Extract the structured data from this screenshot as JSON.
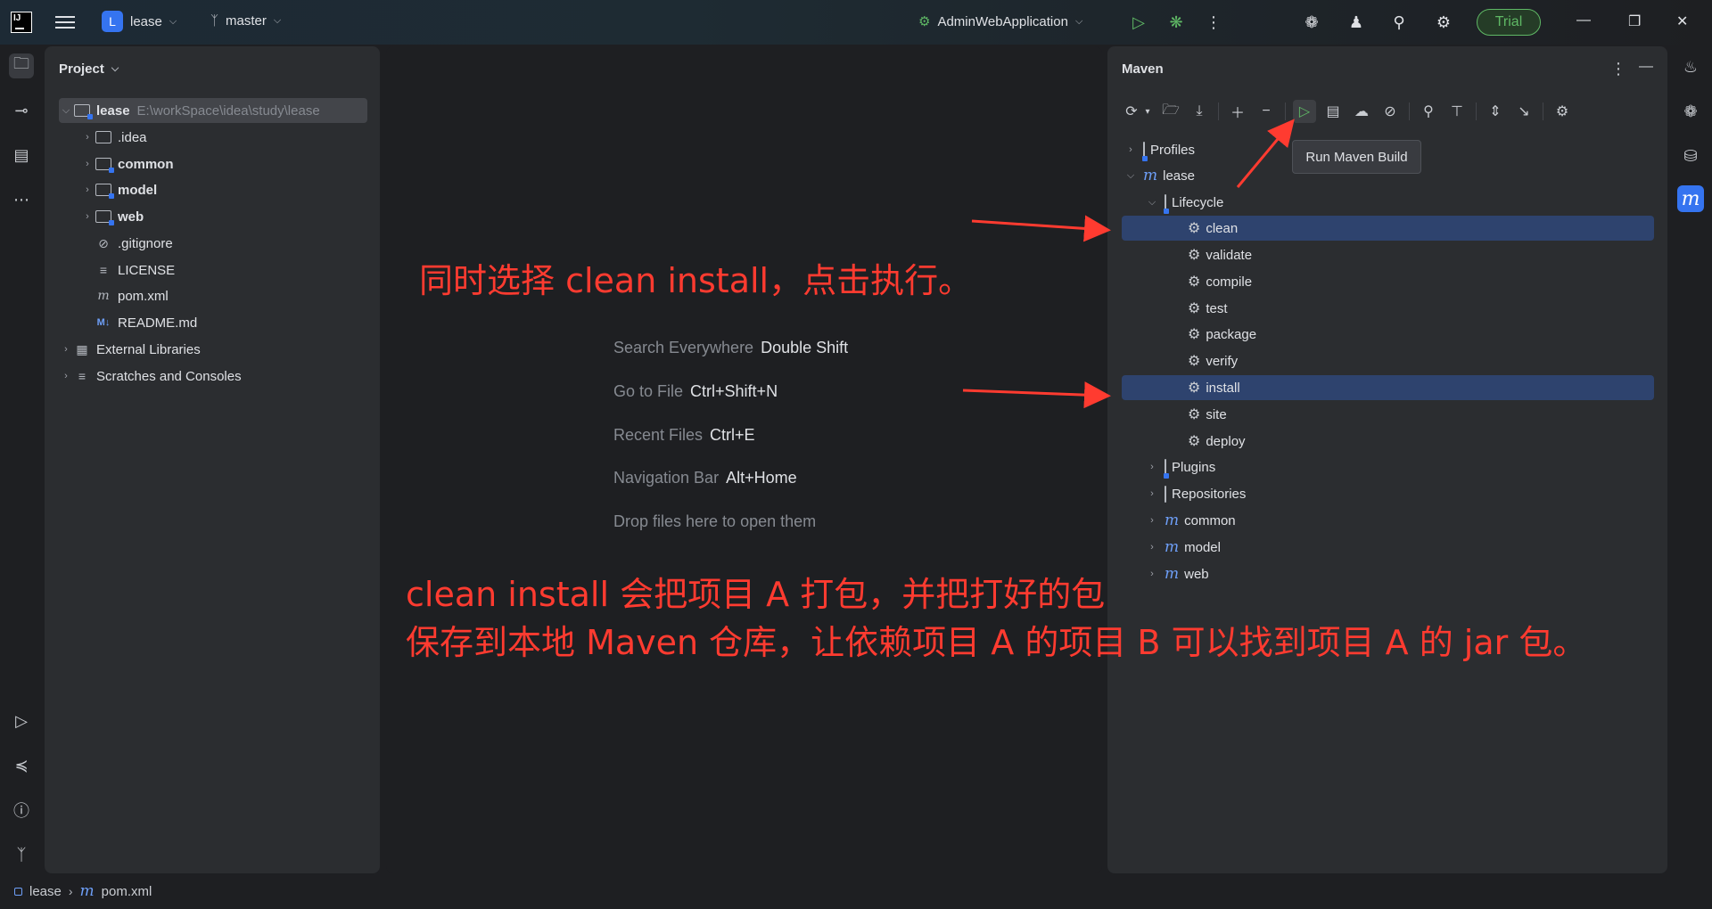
{
  "titlebar": {
    "project_badge": "L",
    "project_name": "lease",
    "branch": "master",
    "run_config": "AdminWebApplication",
    "trial_label": "Trial"
  },
  "project_panel": {
    "title": "Project",
    "root": {
      "name": "lease",
      "path": "E:\\workSpace\\idea\\study\\lease"
    },
    "items": [
      {
        "label": ".idea"
      },
      {
        "label": "common"
      },
      {
        "label": "model"
      },
      {
        "label": "web"
      },
      {
        "label": ".gitignore"
      },
      {
        "label": "LICENSE"
      },
      {
        "label": "pom.xml"
      },
      {
        "label": "README.md"
      },
      {
        "label": "External Libraries"
      },
      {
        "label": "Scratches and Consoles"
      }
    ]
  },
  "editor": {
    "hints": [
      {
        "label": "Search Everywhere",
        "key": "Double Shift"
      },
      {
        "label": "Go to File",
        "key": "Ctrl+Shift+N"
      },
      {
        "label": "Recent Files",
        "key": "Ctrl+E"
      },
      {
        "label": "Navigation Bar",
        "key": "Alt+Home"
      },
      {
        "label": "Drop files here to open them",
        "key": ""
      }
    ]
  },
  "annotations": {
    "top": "同时选择 clean install，点击执行。",
    "bottom_line1": "clean install 会把项目 A 打包，并把打好的包",
    "bottom_line2": "保存到本地 Maven 仓库，让依赖项目 A 的项目 B 可以找到项目 A 的 jar 包。"
  },
  "maven_panel": {
    "title": "Maven",
    "tooltip": "Run Maven Build",
    "tree": {
      "profiles": "Profiles",
      "root": "lease",
      "lifecycle": "Lifecycle",
      "phases": [
        "clean",
        "validate",
        "compile",
        "test",
        "package",
        "verify",
        "install",
        "site",
        "deploy"
      ],
      "plugins": "Plugins",
      "repositories": "Repositories",
      "modules": [
        "common",
        "model",
        "web"
      ]
    },
    "selected_phases": [
      "clean",
      "install"
    ]
  },
  "breadcrumb": {
    "project": "lease",
    "file": "pom.xml"
  },
  "colors": {
    "accent": "#3574f0",
    "selection": "#2e436e",
    "annotation": "#ff3b30",
    "trial": "#5fb865"
  }
}
